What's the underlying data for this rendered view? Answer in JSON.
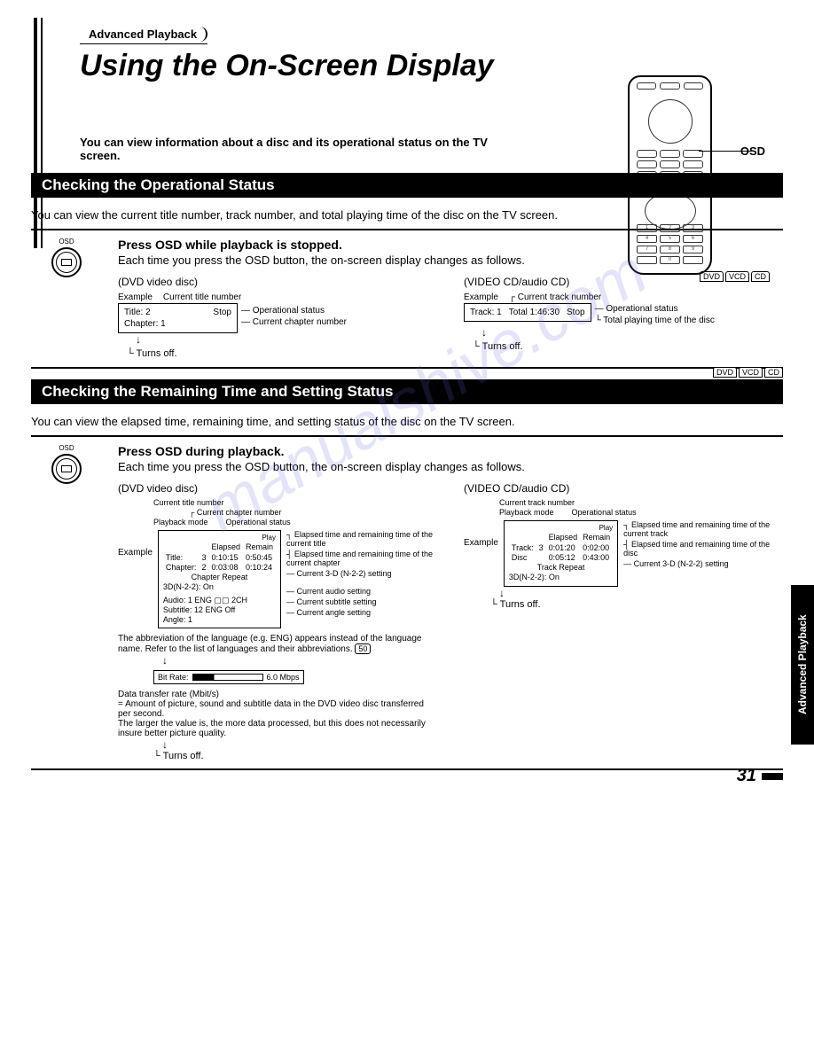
{
  "header": {
    "badge": "Advanced Playback",
    "title": "Using the On-Screen Display",
    "intro": "You can view information about a disc and its operational status on the TV screen.",
    "osd_label": "OSD"
  },
  "disc_types": [
    "DVD",
    "VCD",
    "CD"
  ],
  "section1": {
    "title": "Checking the Operational Status",
    "body": "You can view the current title number, track number, and total playing time of the disc on the TV screen.",
    "step_title": "Press OSD while playback is stopped.",
    "step_sub": "Each time you press the OSD button, the on-screen display changes as follows.",
    "dvd_label": "(DVD video disc)",
    "vcd_label": "(VIDEO CD/audio CD)",
    "example": "Example",
    "dvd": {
      "anno_title": "Current title number",
      "anno_stop": "Stop",
      "anno_op": "Operational status",
      "anno_chapter": "Current chapter number",
      "screen_title": "Title:  2",
      "screen_chapter": "Chapter:  1",
      "turns_off": "Turns off."
    },
    "vcd": {
      "anno_track": "Current track number",
      "anno_stop": "Stop",
      "anno_op": "Operational status",
      "anno_total": "Total playing time of the disc",
      "screen_track": "Track:  1",
      "screen_total": "Total  1:46:30",
      "turns_off": "Turns off."
    }
  },
  "section2": {
    "title": "Checking the Remaining Time and Setting Status",
    "body": "You can view the elapsed time, remaining time, and setting status of the disc on the TV screen.",
    "step_title": "Press OSD during playback.",
    "step_sub": "Each time you press the OSD button, the on-screen display changes as follows.",
    "dvd_label": "(DVD video disc)",
    "vcd_label": "(VIDEO CD/audio CD)",
    "dvd": {
      "labels": {
        "current_title": "Current title number",
        "current_chapter": "Current chapter number",
        "playback_mode": "Playback mode",
        "op_status": "Operational status",
        "elapsed_title": "Elapsed time and remaining time of the current title",
        "elapsed_chapter": "Elapsed time and remaining time of the current chapter",
        "current_3d": "Current 3-D (N-2-2) setting",
        "audio": "Current audio setting",
        "subtitle": "Current subtitle setting",
        "angle": "Current angle setting"
      },
      "screen": {
        "play": "Play",
        "hdr1": "Elapsed",
        "hdr2": "Remain",
        "r1a": "Title:",
        "r1b": "3",
        "r1c": "0:10:15",
        "r1d": "0:50:45",
        "r2a": "Chapter:",
        "r2b": "2",
        "r2c": "0:03:08",
        "r2d": "0:10:24",
        "r3": "Chapter Repeat",
        "r4": "3D(N-2-2): On",
        "r5": "Audio:  1 ENG ▢▢ 2CH",
        "r6": "Subtitle: 12 ENG Off",
        "r7": "Angle:  1"
      },
      "note": "The abbreviation of the language (e.g. ENG) appears instead of the language name. Refer to the list of languages and their abbreviations.",
      "ref": "50",
      "bitrate_label": "Bit Rate:",
      "bitrate_val": "6.0 Mbps",
      "bitrate_note1": "Data transfer rate (Mbit/s)",
      "bitrate_note2": "= Amount of picture, sound and subtitle data in the DVD video disc transferred per second.",
      "bitrate_note3": "The larger the value is, the more data processed, but this does not necessarily insure better picture quality.",
      "turns_off": "Turns off."
    },
    "vcd": {
      "labels": {
        "current_track": "Current track number",
        "playback_mode": "Playback mode",
        "op_status": "Operational status",
        "elapsed_track": "Elapsed time and remaining time of the current track",
        "elapsed_disc": "Elapsed time and remaining time of the disc",
        "current_3d": "Current 3-D (N-2-2) setting"
      },
      "screen": {
        "play": "Play",
        "hdr1": "Elapsed",
        "hdr2": "Remain",
        "r1a": "Track:",
        "r1b": "3",
        "r1c": "0:01:20",
        "r1d": "0:02:00",
        "r2a": "Disc",
        "r2b": "",
        "r2c": "0:05:12",
        "r2d": "0:43:00",
        "r3": "Track Repeat",
        "r4": "3D(N-2-2): On"
      },
      "turns_off": "Turns off."
    }
  },
  "side_tab": "Advanced Playback",
  "page_num": "31",
  "watermark": "manualshive.com",
  "osd_small": "OSD",
  "example_label": "Example"
}
